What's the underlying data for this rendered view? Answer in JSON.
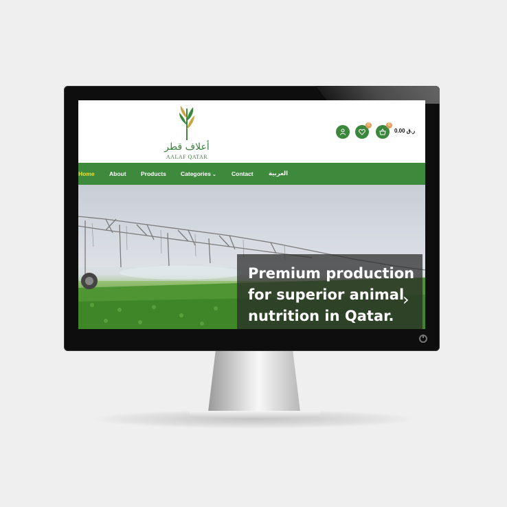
{
  "brand": {
    "name_ar": "أعلاف قطر",
    "name_en": "AALAF QATAR"
  },
  "header": {
    "cart_total": "0.00 ر.ق",
    "wishlist_count": "0",
    "cart_count": "0",
    "icons": [
      "user-icon",
      "heart-icon",
      "basket-icon"
    ]
  },
  "nav": {
    "items": [
      {
        "label": "Home",
        "active": true
      },
      {
        "label": "About"
      },
      {
        "label": "Products"
      },
      {
        "label": "Categories",
        "has_dropdown": true
      },
      {
        "label": "Contact"
      },
      {
        "label": "العربية"
      }
    ]
  },
  "hero": {
    "lines": [
      "Premium production",
      "for superior animal",
      "nutrition in Qatar."
    ]
  },
  "colors": {
    "brand_green": "#3d8a3d",
    "active_nav": "#f2e22a",
    "badge": "#e0a060"
  }
}
